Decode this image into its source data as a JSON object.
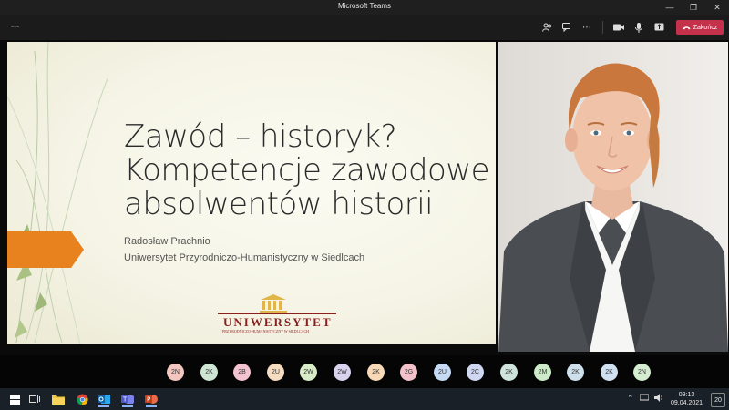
{
  "window": {
    "title": "Microsoft Teams",
    "controls": [
      "minimize-icon",
      "restore-icon",
      "close-icon"
    ]
  },
  "toolbar": {
    "leave_label": "Zakończ",
    "leave_color": "#c4314b"
  },
  "slide": {
    "title_lines": [
      "Zawód – historyk?",
      "Kompetencje zawodowe",
      "absolwentów historii"
    ],
    "author": "Radosław Prachnio",
    "university": "Uniwersytet Przyrodniczo-Humanistyczny w Siedlcach",
    "logo_word": "UNIWERSYTET",
    "logo_sub": "PRZYRODNICZO-HUMANISTYCZNY W SIEDLCACH",
    "accent_color": "#e8821e"
  },
  "participants": [
    {
      "initials": "2N",
      "color": "#f4c6c0"
    },
    {
      "initials": "2K",
      "color": "#cfe6d5"
    },
    {
      "initials": "2B",
      "color": "#f3c4cf"
    },
    {
      "initials": "2U",
      "color": "#f6dcc0"
    },
    {
      "initials": "2W",
      "color": "#d8ecc7"
    },
    {
      "initials": "2W",
      "color": "#d9d3ee"
    },
    {
      "initials": "2K",
      "color": "#f7d9b8"
    },
    {
      "initials": "2G",
      "color": "#f3c1c9"
    },
    {
      "initials": "2U",
      "color": "#c7daf3"
    },
    {
      "initials": "2C",
      "color": "#cfd8f0"
    },
    {
      "initials": "2K",
      "color": "#cfe4dc"
    },
    {
      "initials": "2M",
      "color": "#cdebc8"
    },
    {
      "initials": "2K",
      "color": "#cde0ec"
    },
    {
      "initials": "2K",
      "color": "#cfe0f0"
    },
    {
      "initials": "2N",
      "color": "#d4ecd0"
    }
  ],
  "taskbar": {
    "time": "09:13",
    "date": "09.04.2021",
    "notifications": "20"
  }
}
